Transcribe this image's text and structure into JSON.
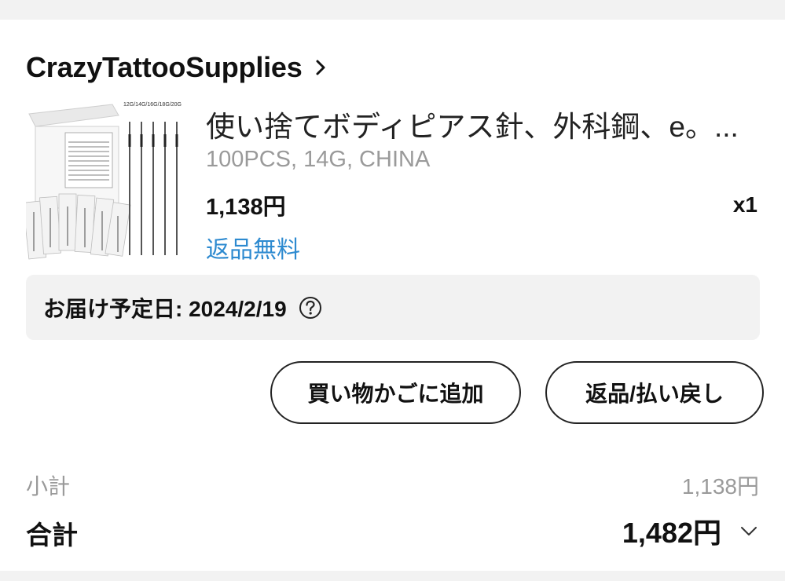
{
  "store": {
    "name": "CrazyTattooSupplies"
  },
  "product": {
    "title": "使い捨てボディピアス針、外科鋼、e。...",
    "image_label": "12G/14G/16G/18G/20G",
    "variant": "100PCS, 14G, CHINA",
    "price": "1,138円",
    "quantity": "x1",
    "shipping_note": "返品無料"
  },
  "delivery": {
    "label": "お届け予定日: 2024/2/19"
  },
  "actions": {
    "add_to_cart": "買い物かごに追加",
    "return_refund": "返品/払い戻し"
  },
  "summary": {
    "subtotal_label": "小計",
    "subtotal_value": "1,138円",
    "total_label": "合計",
    "total_value": "1,482円"
  },
  "icons": {
    "store": "chevron-right-icon",
    "help": "question-circle-icon",
    "total": "chevron-down-icon"
  },
  "colors": {
    "background": "#f2f2f2",
    "card": "#ffffff",
    "link_blue": "#2d8ad0",
    "muted_text": "#9a9a9a",
    "primary_text": "#111111"
  }
}
